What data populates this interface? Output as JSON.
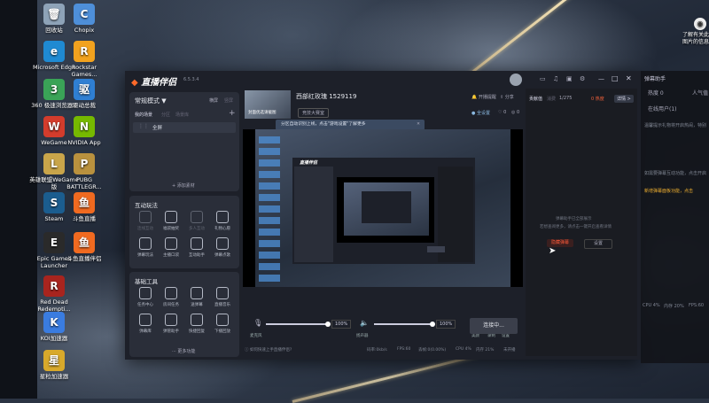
{
  "desktop_icons": [
    {
      "label": "回收站",
      "color": "#8ea3b8",
      "glyph": "🗑"
    },
    {
      "label": "Chopix",
      "color": "#4e8fd9",
      "glyph": "C"
    },
    {
      "label": "Microsoft Edge",
      "color": "#1f8ad2",
      "glyph": "e"
    },
    {
      "label": "Rockstar Games...",
      "color": "#f2a21e",
      "glyph": "R"
    },
    {
      "label": "360 极速浏览器X",
      "color": "#3aa357",
      "glyph": "3"
    },
    {
      "label": "驱动总裁",
      "color": "#2f7fd3",
      "glyph": "驱"
    },
    {
      "label": "WeGame",
      "color": "#d33c2c",
      "glyph": "W"
    },
    {
      "label": "NVIDIA App",
      "color": "#76b900",
      "glyph": "N"
    },
    {
      "label": "英雄联盟WeGame版",
      "color": "#c9a54a",
      "glyph": "L"
    },
    {
      "label": "PUBG BATTLEGR...",
      "color": "#b9913e",
      "glyph": "P"
    },
    {
      "label": "Steam",
      "color": "#1b5d8f",
      "glyph": "S"
    },
    {
      "label": "斗鱼直播",
      "color": "#f06a20",
      "glyph": "鱼"
    },
    {
      "label": "Epic Games Launcher",
      "color": "#2a2a2a",
      "glyph": "E"
    },
    {
      "label": "斗鱼直播伴侣",
      "color": "#f06a20",
      "glyph": "鱼"
    },
    {
      "label": "Red Dead Redempti...",
      "color": "#a8241e",
      "glyph": "R"
    },
    {
      "label": "KOI加速器",
      "color": "#3a7ce0",
      "glyph": "K"
    },
    {
      "label": "星粒加速器",
      "color": "#d8a92b",
      "glyph": "星"
    }
  ],
  "top_right_label": "了解有关此图片的信息",
  "app": {
    "name": "直播伴侣",
    "version": "6.5.3.4",
    "window_controls": [
      "—",
      "□",
      "✕"
    ]
  },
  "scene_panel": {
    "mode": "常规模式 ▼",
    "actions": [
      "横屏",
      "竖屏"
    ],
    "tabs": [
      "我的场景",
      "分区",
      "场景库"
    ],
    "scene_item": "全屏",
    "add_source": "+ 添加素材"
  },
  "interactive": {
    "title": "互动玩法",
    "tools": [
      "连线互动",
      "福袋抽奖",
      "多人互动",
      "礼物心愿",
      "弹幕玩法",
      "主播口袋",
      "互动助手",
      "弹幕点歌"
    ]
  },
  "basic_tools": {
    "title": "基础工具",
    "tools": [
      "任务中心",
      "房间任务",
      "送弹幕",
      "直播音乐",
      "弹幕库",
      "弹管助手",
      "快捷回复",
      "下播回放"
    ],
    "more": "··· 更多功能"
  },
  "room": {
    "title": "西部红玫瑰 1529119",
    "thumb_label": "封面优选请截图",
    "category": "竞技大赛室",
    "links": [
      "开播提醒",
      "分享"
    ],
    "settings": "全设置",
    "counts": [
      "0",
      "0"
    ],
    "tooltip": "分区自动识别上线，点击\"游戏设置\"了解更多"
  },
  "inner_app": {
    "name": "直播伴侣"
  },
  "controls": {
    "mic_label": "麦克风",
    "mic_volume": "100%",
    "speaker_label": "扬声器",
    "speaker_volume": "100%",
    "buttons": [
      "美颜",
      "录制",
      "设置"
    ],
    "go_live": "连接中..."
  },
  "status_bar": {
    "hint": "如何快速上手直播伴侣?",
    "items": [
      "码率:0kb/s",
      "FPS:60",
      "丢帧:0(0.00%)",
      "CPU 4%",
      "内存 21%",
      "未开播"
    ]
  },
  "right_panel": {
    "tabs": [
      "贡献值",
      "消费"
    ],
    "count": "1/275",
    "badge": "0 热度",
    "detail_btn": "详情 >",
    "empty_line1": "弹幕助手已全部展示",
    "empty_line2": "若想查阅更多，请点击一键开启查看详情",
    "link": "一键开启",
    "btn_primary": "隐藏弹幕",
    "btn_secondary": "设置"
  },
  "extension": {
    "title": "弹幕助手",
    "rows": [
      "热度 0",
      "人气值",
      "在线用户(1)"
    ],
    "texts": [
      "温馨提示礼物将开启热闹，特别开启点亮榜单...",
      "如需要弹幕互动功能，点击开启弹幕...",
      "新增弹幕面板功能，点击"
    ],
    "footer": [
      "CPU 4%",
      "内存 20%",
      "FPS:60"
    ]
  }
}
